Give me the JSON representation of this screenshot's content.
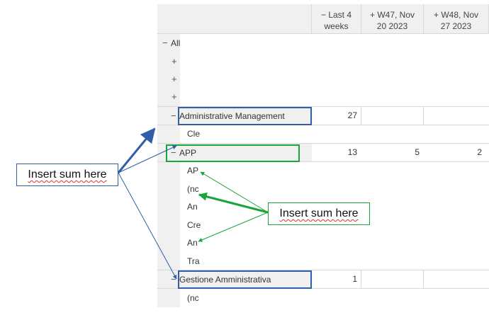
{
  "columns": [
    {
      "toggle": "−",
      "line1": "Last 4",
      "line2": "weeks"
    },
    {
      "toggle": "+",
      "line1": "W47, Nov",
      "line2": "20 2023"
    },
    {
      "toggle": "+",
      "line1": "W48, Nov",
      "line2": "27 2023"
    }
  ],
  "rows": {
    "all": {
      "toggle": "−",
      "label": "All"
    },
    "collapsed": [
      {
        "toggle": "+"
      },
      {
        "toggle": "+"
      },
      {
        "toggle": "+"
      }
    ],
    "admin": {
      "toggle": "−",
      "label": "Administrative Management",
      "last4": "27"
    },
    "admin_child": {
      "label": "Cle"
    },
    "app": {
      "toggle": "−",
      "label": "APP",
      "last4": "13",
      "w47": "5",
      "w48": "2"
    },
    "app_children": [
      {
        "label": "AP"
      },
      {
        "label": "(nc"
      },
      {
        "label": "An"
      },
      {
        "label": "Cre"
      },
      {
        "label": "An"
      },
      {
        "label": "Tra"
      }
    ],
    "gestione": {
      "toggle": "−",
      "label": "Gestione Amministrativa",
      "last4": "1"
    },
    "gestione_child": {
      "label": "(nc"
    }
  },
  "callouts": {
    "blue": {
      "text": "Insert sum here",
      "color": "#2e5fa8"
    },
    "green": {
      "text": "Insert sum here",
      "color": "#1aa53a"
    }
  },
  "colors": {
    "header_bg": "#f0f0f0",
    "grid": "#d8d8d8",
    "highlight_blue": "#2e5fa8",
    "highlight_green": "#1aa53a"
  }
}
